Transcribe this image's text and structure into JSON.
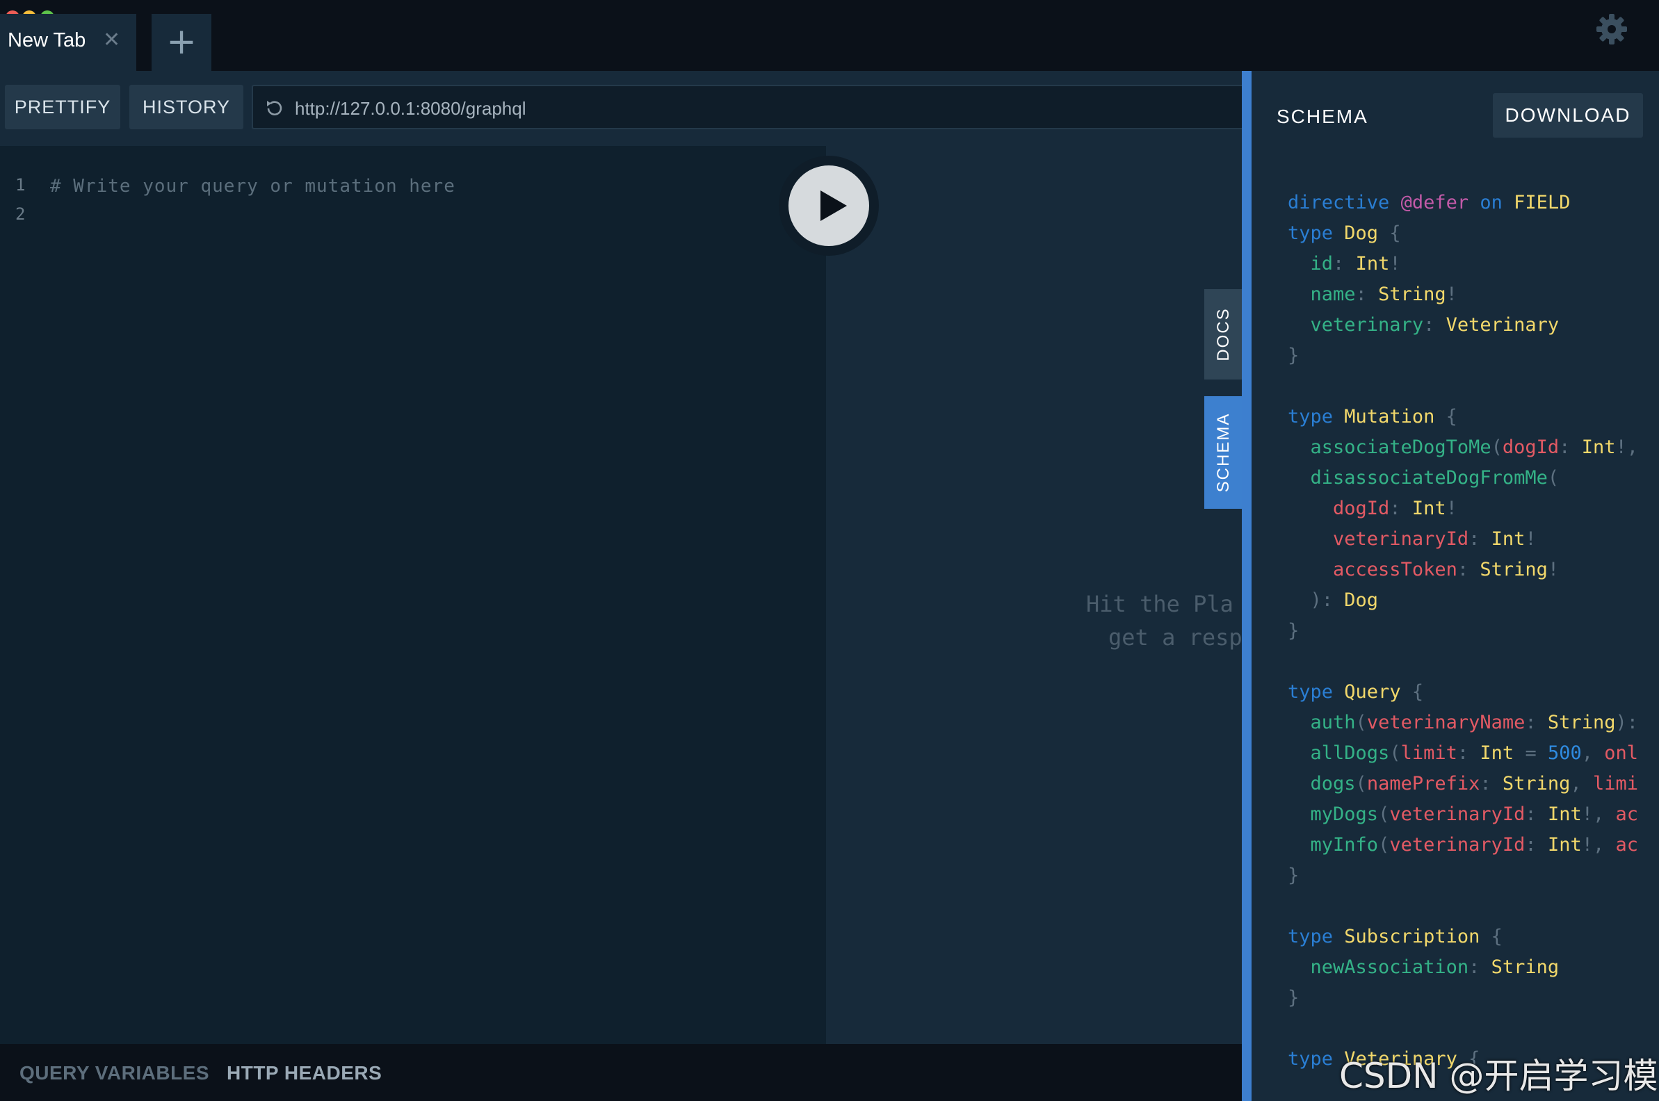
{
  "window": {
    "tab_title": "New Tab"
  },
  "toolbar": {
    "prettify": "PRETTIFY",
    "history": "HISTORY",
    "endpoint": "http://127.0.0.1:8080/graphql"
  },
  "editor": {
    "line_numbers": [
      "1",
      "2"
    ],
    "placeholder_comment": "# Write your query or mutation here"
  },
  "result": {
    "hint_line1": "Hit the Pla",
    "hint_line2": "get a resp"
  },
  "side_tabs": {
    "docs": "DOCS",
    "schema": "SCHEMA"
  },
  "footer": {
    "query_variables": "QUERY VARIABLES",
    "http_headers": "HTTP HEADERS"
  },
  "schema_panel": {
    "title": "SCHEMA",
    "download": "DOWNLOAD",
    "sdl_lines": [
      "directive @defer on FIELD",
      "type Dog {",
      "  id: Int!",
      "  name: String!",
      "  veterinary: Veterinary",
      "}",
      "",
      "type Mutation {",
      "  associateDogToMe(dogId: Int!,",
      "  disassociateDogFromMe(",
      "    dogId: Int!",
      "    veterinaryId: Int!",
      "    accessToken: String!",
      "  ): Dog",
      "}",
      "",
      "type Query {",
      "  auth(veterinaryName: String):",
      "  allDogs(limit: Int = 500, onl",
      "  dogs(namePrefix: String, limi",
      "  myDogs(veterinaryId: Int!, ac",
      "  myInfo(veterinaryId: Int!, ac",
      "}",
      "",
      "type Subscription {",
      "  newAssociation: String",
      "}",
      "",
      "type Veterinary {"
    ]
  },
  "watermark": "CSDN @开启学习模式",
  "colors": {
    "background": "#172a3a",
    "topbar": "#0b1119",
    "accent": "#3d80cf",
    "keyword": "#2a7ed3",
    "type": "#f2d86b",
    "field": "#34b287",
    "argument": "#e35a64",
    "directive": "#c25aa8"
  }
}
